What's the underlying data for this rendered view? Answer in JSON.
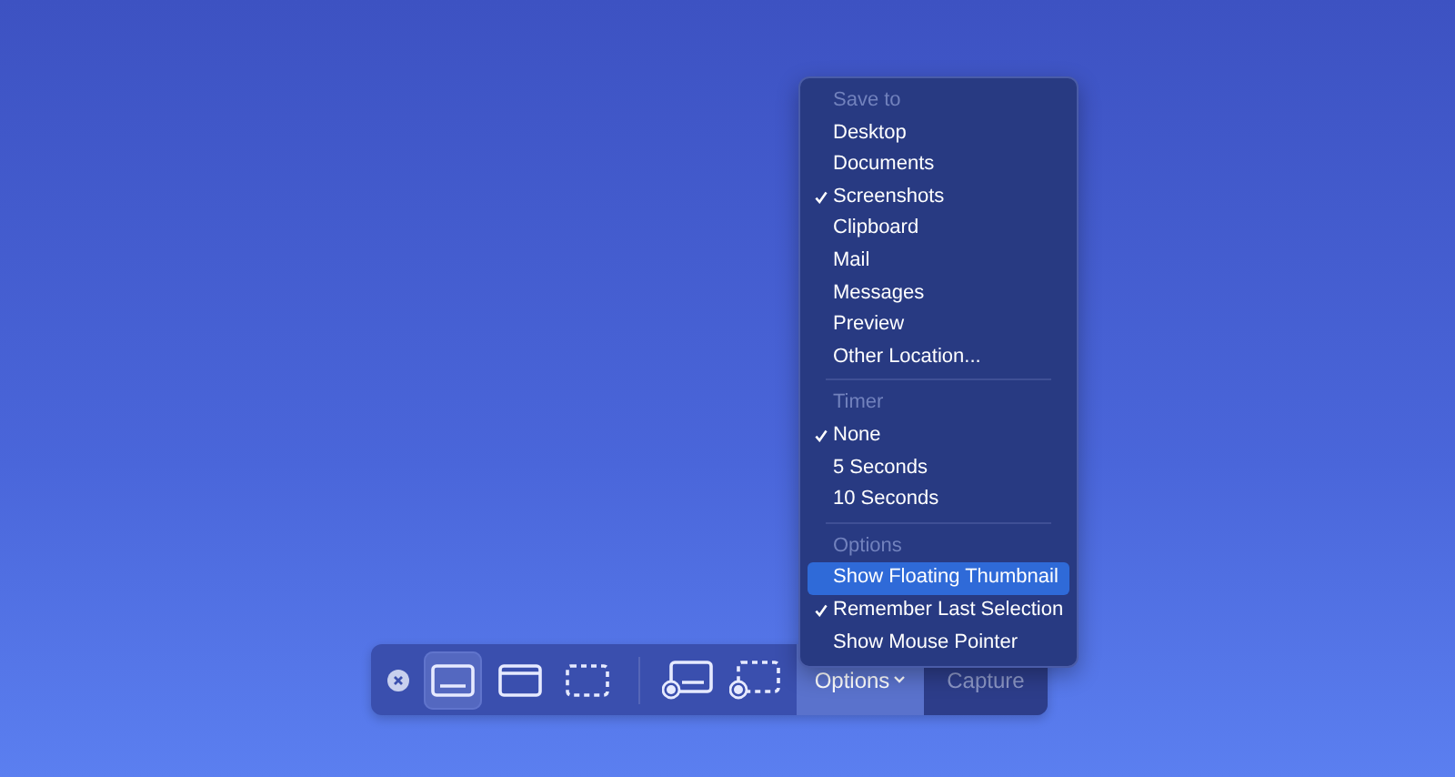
{
  "toolbar": {
    "buttons": [
      {
        "kind": "close"
      },
      {
        "kind": "entire-screen",
        "selected": true
      },
      {
        "kind": "window",
        "selected": false
      },
      {
        "kind": "selection",
        "selected": false
      },
      {
        "kind": "divider"
      },
      {
        "kind": "record-screen",
        "selected": false
      },
      {
        "kind": "record-selection",
        "selected": false
      }
    ],
    "options": {
      "label": "Options",
      "expanded": true
    },
    "capture": {
      "label": "Capture",
      "disabled": true
    }
  },
  "menu": {
    "sections": [
      {
        "heading": "Save to",
        "items": [
          {
            "label": "Desktop",
            "checked": false,
            "selected": false
          },
          {
            "label": "Documents",
            "checked": false,
            "selected": false
          },
          {
            "label": "Screenshots",
            "checked": true,
            "selected": false
          },
          {
            "label": "Clipboard",
            "checked": false,
            "selected": false
          },
          {
            "label": "Mail",
            "checked": false,
            "selected": false
          },
          {
            "label": "Messages",
            "checked": false,
            "selected": false
          },
          {
            "label": "Preview",
            "checked": false,
            "selected": false
          },
          {
            "label": "Other Location...",
            "checked": false,
            "selected": false
          }
        ]
      },
      {
        "heading": "Timer",
        "items": [
          {
            "label": "None",
            "checked": true,
            "selected": false
          },
          {
            "label": "5 Seconds",
            "checked": false,
            "selected": false
          },
          {
            "label": "10 Seconds",
            "checked": false,
            "selected": false
          }
        ]
      },
      {
        "heading": "Options",
        "items": [
          {
            "label": "Show Floating Thumbnail",
            "checked": false,
            "selected": true
          },
          {
            "label": "Remember Last Selection",
            "checked": true,
            "selected": false
          },
          {
            "label": "Show Mouse Pointer",
            "checked": false,
            "selected": false
          }
        ]
      }
    ]
  }
}
